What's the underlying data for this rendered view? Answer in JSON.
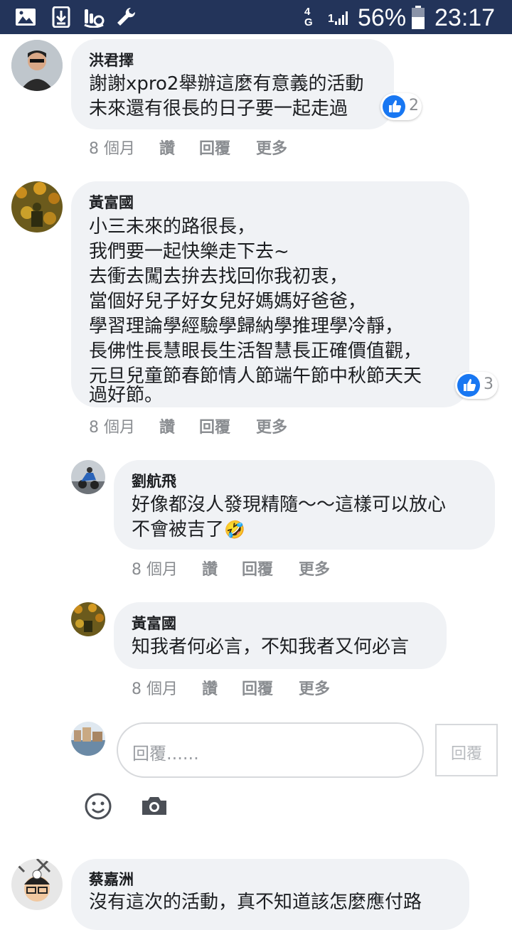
{
  "status_bar": {
    "network": "4G",
    "sim": "1",
    "battery": "56%",
    "time": "23:17",
    "icons": [
      "image-icon",
      "download-icon",
      "touch-icon",
      "wrench-icon",
      "signal-icon",
      "battery-icon"
    ]
  },
  "colors": {
    "status_bar_bg": "#23345a",
    "bubble_bg": "#f0f2f5",
    "like_blue": "#1877f2",
    "meta_gray": "#8a8d91"
  },
  "comments": [
    {
      "author": "洪君擇",
      "lines": [
        "謝謝xpro2舉辦這麼有意義的活動",
        "未來還有很長的日子要一起走過"
      ],
      "likes": "2",
      "time": "8 個月",
      "like_label": "讚",
      "reply_label": "回覆",
      "more_label": "更多"
    },
    {
      "author": "黃富國",
      "lines": [
        "小三未來的路很長，",
        "我們要一起快樂走下去~",
        "去衝去闖去拚去找回你我初衷，",
        "當個好兒子好女兒好媽媽好爸爸，",
        "學習理論學經驗學歸納學推理學冷靜，",
        "長佛性長慧眼長生活智慧長正確價值觀，",
        "元旦兒童節春節情人節端午節中秋節天天",
        "過好節。"
      ],
      "likes": "3",
      "time": "8 個月",
      "like_label": "讚",
      "reply_label": "回覆",
      "more_label": "更多"
    }
  ],
  "replies": [
    {
      "author": "劉航飛",
      "lines": [
        "好像都沒人發現精隨～～這樣可以放心",
        "不會被吉了"
      ],
      "emoji": "🤣",
      "time": "8 個月",
      "like_label": "讚",
      "reply_label": "回覆",
      "more_label": "更多"
    },
    {
      "author": "黃富國",
      "lines": [
        "知我者何必言，不知我者又何必言"
      ],
      "time": "8 個月",
      "like_label": "讚",
      "reply_label": "回覆",
      "more_label": "更多"
    }
  ],
  "reply_box": {
    "placeholder": "回覆......",
    "submit_label": "回覆",
    "icons": [
      "emoji-icon",
      "camera-icon"
    ]
  },
  "next_comment": {
    "author": "蔡嘉洲",
    "first_line": "沒有這次的活動，真不知道該怎麼應付路"
  }
}
